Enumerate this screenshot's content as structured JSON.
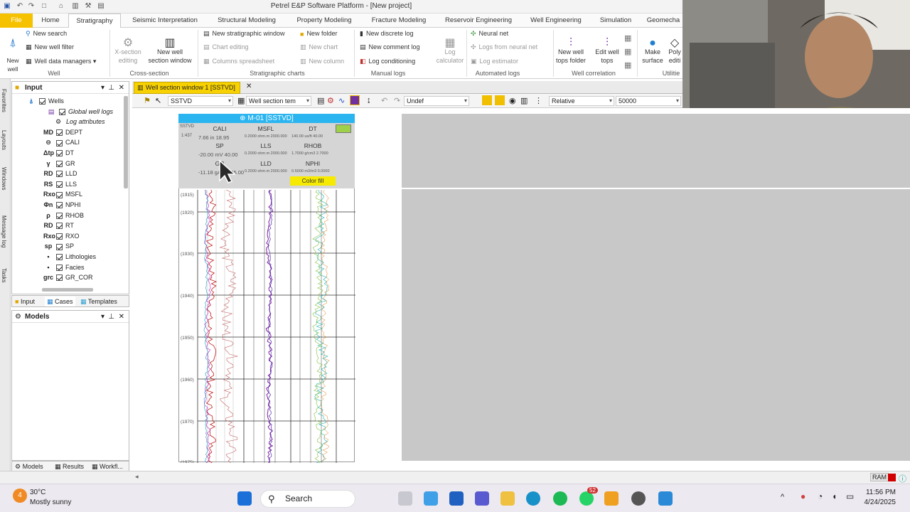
{
  "titlebar": {
    "title": "Petrel E&P Software Platform - [New project]"
  },
  "ribbon_tabs": [
    "File",
    "Home",
    "Stratigraphy",
    "Seismic Interpretation",
    "Structural Modeling",
    "Property Modeling",
    "Fracture Modeling",
    "Reservoir Engineering",
    "Well Engineering",
    "Simulation",
    "Geomecha"
  ],
  "ribbon": {
    "well": {
      "new_well": "New\nwell",
      "new_search": "New search",
      "new_well_filter": "New well filter",
      "well_data_managers": "Well data managers",
      "group": "Well"
    },
    "cross": {
      "x_section": "X-section\nediting",
      "new_well_section": "New well\nsection window",
      "group": "Cross-section"
    },
    "strat": {
      "new_strat_window": "New stratigraphic window",
      "chart_editing": "Chart editing",
      "columns_spreadsheet": "Columns spreadsheet",
      "new_folder": "New folder",
      "new_chart": "New chart",
      "new_column": "New column",
      "group": "Stratigraphic charts"
    },
    "manual": {
      "new_discrete_log": "New discrete log",
      "new_comment_log": "New comment log",
      "log_conditioning": "Log conditioning",
      "log_calculator": "Log\ncalculator",
      "group": "Manual logs"
    },
    "auto": {
      "neural_net": "Neural net",
      "logs_from_nn": "Logs from neural net",
      "log_estimator": "Log estimator",
      "group": "Automated logs"
    },
    "corr": {
      "new_well_tops_folder": "New well\ntops folder",
      "edit_well_tops": "Edit well\ntops",
      "group": "Well correlation"
    },
    "util": {
      "make_surface": "Make\nsurface",
      "poly": "Poly\nediti",
      "group": "Utilitie"
    }
  },
  "left_rail": [
    "Favorites",
    "Layouts",
    "Windows",
    "Message log",
    "Tasks"
  ],
  "input_panel": {
    "title": "Input",
    "items": [
      {
        "label": "Wells",
        "icon": "wells-icon"
      },
      {
        "label": "Global well logs",
        "icon": "folder-icon"
      },
      {
        "label": "Log attributes",
        "icon": "attributes-icon"
      },
      {
        "label": "DEPT",
        "icon": "MD"
      },
      {
        "label": "CALI",
        "icon": "⊖"
      },
      {
        "label": "DT",
        "icon": "Δtp"
      },
      {
        "label": "GR",
        "icon": "γ"
      },
      {
        "label": "LLD",
        "icon": "RD"
      },
      {
        "label": "LLS",
        "icon": "RS"
      },
      {
        "label": "MSFL",
        "icon": "Rxo"
      },
      {
        "label": "NPHI",
        "icon": "Φn"
      },
      {
        "label": "RHOB",
        "icon": "ρ"
      },
      {
        "label": "RT",
        "icon": "RD"
      },
      {
        "label": "RXO",
        "icon": "Rxo"
      },
      {
        "label": "SP",
        "icon": "sp"
      },
      {
        "label": "Lithologies",
        "icon": "lith"
      },
      {
        "label": "Facies",
        "icon": "facies"
      },
      {
        "label": "GR_COR",
        "icon": "grc"
      }
    ]
  },
  "input_tabs": [
    "Input",
    "Cases",
    "Templates"
  ],
  "models_panel": {
    "title": "Models"
  },
  "bottom_tabs": [
    "Models",
    "Results",
    "Workfl..."
  ],
  "doc_tab": {
    "label": "Well section window 1 [SSTVD]"
  },
  "ws_toolbar": {
    "domain": "SSTVD",
    "template": "Well section tem",
    "undef": "Undef",
    "mode": "Relative",
    "scale": "50000"
  },
  "well": {
    "name": "M-01 [SSTVD]",
    "tvd_label": "SSTVD",
    "tvd_scale": "1:437",
    "logs": [
      {
        "name": "CALI",
        "range": "7.66  in  18.95"
      },
      {
        "name": "MSFL",
        "range": "0.2000 ohm.m 2000.000"
      },
      {
        "name": "DT",
        "range": "140.00 us/ft 40.00"
      },
      {
        "name": "SP",
        "range": "-20.00 mV 40.00"
      },
      {
        "name": "LLS",
        "range": "0.2000 ohm.m 2000.000"
      },
      {
        "name": "RHOB",
        "range": "1.7000 g/cm3 2.7000"
      },
      {
        "name": "GR",
        "range": "-11.18 gAPI 145.00"
      },
      {
        "name": "LLD",
        "range": "0.2000 ohm.m 2000.000"
      },
      {
        "name": "NPHI",
        "range": "0.5000 m3/m3 0.0000"
      }
    ],
    "color_fill": "Color fill",
    "depths": [
      "(1915)",
      "(1920)",
      "(1930)",
      "(1940)",
      "(1950)",
      "(1960)",
      "(1970)",
      "(1975)"
    ]
  },
  "statusbar": {
    "ram": "RAM"
  },
  "taskbar": {
    "temp": "30°C",
    "weather": "Mostly sunny",
    "search": "Search",
    "time": "11:56 PM",
    "date": "4/24/2025",
    "badge_weather": "4",
    "badge_whatsapp": "52"
  },
  "colors": {
    "accent": "#f6c200",
    "well_header": "#2bb5f0",
    "track_grey": "#c8c8c8"
  }
}
